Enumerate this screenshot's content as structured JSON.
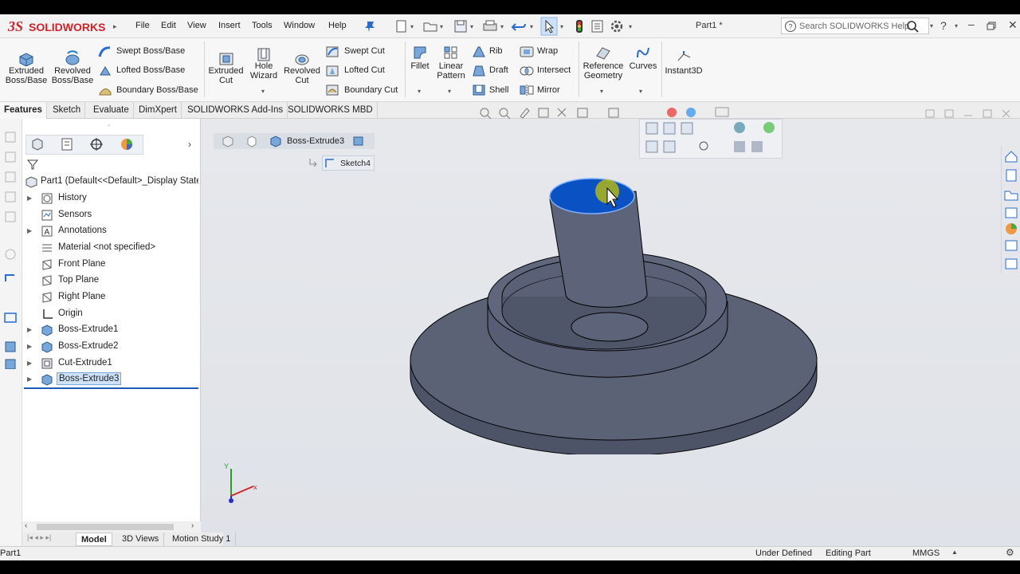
{
  "app": {
    "brand": "SOLIDWORKS",
    "document_title": "Part1 *",
    "menu": [
      "File",
      "Edit",
      "View",
      "Insert",
      "Tools",
      "Window",
      "Help"
    ],
    "search_placeholder": "Search SOLIDWORKS Help",
    "help_label": "?"
  },
  "ribbon": {
    "extruded_boss": "Extruded Boss/Base",
    "revolved_boss": "Revolved Boss/Base",
    "swept_boss": "Swept Boss/Base",
    "lofted_boss": "Lofted Boss/Base",
    "boundary_boss": "Boundary Boss/Base",
    "extruded_cut": "Extruded Cut",
    "hole_wizard": "Hole Wizard",
    "revolved_cut": "Revolved Cut",
    "swept_cut": "Swept Cut",
    "lofted_cut": "Lofted Cut",
    "boundary_cut": "Boundary Cut",
    "fillet": "Fillet",
    "linear_pattern": "Linear Pattern",
    "rib": "Rib",
    "draft": "Draft",
    "shell": "Shell",
    "wrap": "Wrap",
    "intersect": "Intersect",
    "mirror": "Mirror",
    "reference_geometry": "Reference Geometry",
    "curves": "Curves",
    "instant3d": "Instant3D"
  },
  "command_tabs": [
    "Features",
    "Sketch",
    "Evaluate",
    "DimXpert",
    "SOLIDWORKS Add-Ins",
    "SOLIDWORKS MBD"
  ],
  "tree": {
    "root": "Part1  (Default<<Default>_Display State",
    "items": [
      {
        "label": "History",
        "expandable": true
      },
      {
        "label": "Sensors",
        "expandable": false
      },
      {
        "label": "Annotations",
        "expandable": true
      },
      {
        "label": "Material <not specified>",
        "expandable": false
      },
      {
        "label": "Front Plane",
        "expandable": false
      },
      {
        "label": "Top Plane",
        "expandable": false
      },
      {
        "label": "Right Plane",
        "expandable": false
      },
      {
        "label": "Origin",
        "expandable": false
      },
      {
        "label": "Boss-Extrude1",
        "expandable": true
      },
      {
        "label": "Boss-Extrude2",
        "expandable": true
      },
      {
        "label": "Cut-Extrude1",
        "expandable": true
      },
      {
        "label": "Boss-Extrude3",
        "expandable": true,
        "selected": true
      }
    ]
  },
  "breadcrumb": {
    "feature": "Boss-Extrude3",
    "sketch": "Sketch4"
  },
  "bottom_tabs": [
    "Model",
    "3D Views",
    "Motion Study 1"
  ],
  "status": {
    "doc": "Part1",
    "sketch_state": "Under Defined",
    "mode": "Editing Part",
    "units": "MMGS"
  },
  "axis_labels": {
    "x": "x",
    "y": "Y"
  },
  "colors": {
    "selection_blue": "#0a52c4",
    "model_gray": "#5b6175",
    "brand_red": "#d2232a"
  }
}
